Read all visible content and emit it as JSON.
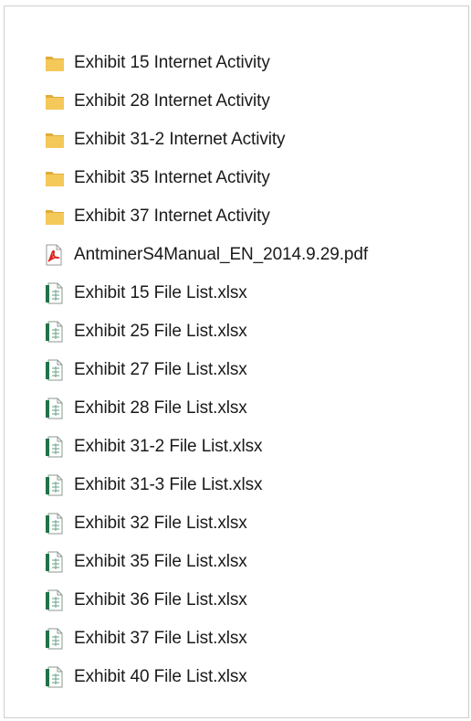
{
  "files": [
    {
      "name": "Exhibit 15 Internet Activity",
      "type": "folder",
      "icon": "folder-icon"
    },
    {
      "name": "Exhibit 28 Internet Activity",
      "type": "folder",
      "icon": "folder-icon"
    },
    {
      "name": "Exhibit 31-2 Internet Activity",
      "type": "folder",
      "icon": "folder-icon"
    },
    {
      "name": "Exhibit 35 Internet Activity",
      "type": "folder",
      "icon": "folder-icon"
    },
    {
      "name": "Exhibit 37 Internet Activity",
      "type": "folder",
      "icon": "folder-icon"
    },
    {
      "name": "AntminerS4Manual_EN_2014.9.29.pdf",
      "type": "pdf",
      "icon": "pdf-file-icon"
    },
    {
      "name": "Exhibit 15 File List.xlsx",
      "type": "xlsx",
      "icon": "excel-file-icon"
    },
    {
      "name": "Exhibit 25 File List.xlsx",
      "type": "xlsx",
      "icon": "excel-file-icon"
    },
    {
      "name": "Exhibit 27 File List.xlsx",
      "type": "xlsx",
      "icon": "excel-file-icon"
    },
    {
      "name": "Exhibit 28 File List.xlsx",
      "type": "xlsx",
      "icon": "excel-file-icon"
    },
    {
      "name": "Exhibit 31-2 File List.xlsx",
      "type": "xlsx",
      "icon": "excel-file-icon"
    },
    {
      "name": "Exhibit 31-3 File List.xlsx",
      "type": "xlsx",
      "icon": "excel-file-icon"
    },
    {
      "name": "Exhibit 32 File List.xlsx",
      "type": "xlsx",
      "icon": "excel-file-icon"
    },
    {
      "name": "Exhibit 35 File List.xlsx",
      "type": "xlsx",
      "icon": "excel-file-icon"
    },
    {
      "name": "Exhibit 36 File List.xlsx",
      "type": "xlsx",
      "icon": "excel-file-icon"
    },
    {
      "name": "Exhibit 37 File List.xlsx",
      "type": "xlsx",
      "icon": "excel-file-icon"
    },
    {
      "name": "Exhibit 40 File List.xlsx",
      "type": "xlsx",
      "icon": "excel-file-icon"
    }
  ],
  "colors": {
    "folder": "#f5c85a",
    "folder_dark": "#e0ac36",
    "pdf_red": "#d8241c",
    "excel_green": "#217346",
    "text": "#1a1a1a",
    "border": "#cfcfcf"
  }
}
